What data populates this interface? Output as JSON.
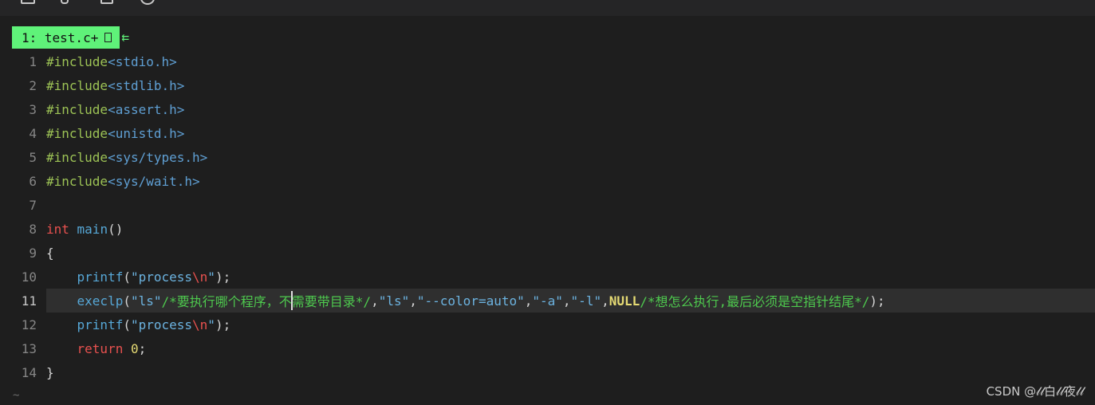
{
  "toolbar": {
    "icons": [
      "panel-icon",
      "pin-icon",
      "copy-icon",
      "info-icon"
    ]
  },
  "tabline": {
    "active_tab": "1: test.c+",
    "modified_marker": "",
    "arrow": "⇇"
  },
  "editor": {
    "line_numbers": [
      "1",
      "2",
      "3",
      "4",
      "5",
      "6",
      "7",
      "8",
      "9",
      "10",
      "11",
      "12",
      "13",
      "14"
    ],
    "current_line": 11,
    "lines": {
      "l1": {
        "pre": "#include",
        "inc": "<stdio.h>"
      },
      "l2": {
        "pre": "#include",
        "inc": "<stdlib.h>"
      },
      "l3": {
        "pre": "#include",
        "inc": "<assert.h>"
      },
      "l4": {
        "pre": "#include",
        "inc": "<unistd.h>"
      },
      "l5": {
        "pre": "#include",
        "inc": "<sys/types.h>"
      },
      "l6": {
        "pre": "#include",
        "inc": "<sys/wait.h>"
      },
      "l8": {
        "type": "int",
        "name": " main",
        "rest": "()"
      },
      "l9": {
        "brace": "{"
      },
      "l10": {
        "indent": "    ",
        "fn": "printf",
        "open": "(",
        "str1": "\"process",
        "esc": "\\n",
        "str2": "\"",
        "close": ");"
      },
      "l11": {
        "indent": "    ",
        "fn": "execlp",
        "open": "(",
        "arg1": "\"ls\"",
        "cmt1a": "/*要执行哪个程序，不",
        "cmt1b": "需要带目录*/",
        "sep1": ",",
        "arg2": "\"ls\"",
        "sep2": ",",
        "arg3": "\"--color=auto\"",
        "sep3": ",",
        "arg4": "\"-a\"",
        "sep4": ",",
        "arg5": "\"-l\"",
        "sep5": ",",
        "null": "NULL",
        "cmt2": "/*想怎么执行,最后必须是空指针结尾*/",
        "close": ");"
      },
      "l12": {
        "indent": "    ",
        "fn": "printf",
        "open": "(",
        "str1": "\"process",
        "esc": "\\n",
        "str2": "\"",
        "close": ");"
      },
      "l13": {
        "indent": "    ",
        "ret": "return",
        "space": " ",
        "num": "0",
        "semi": ";"
      },
      "l14": {
        "brace": "}"
      }
    }
  },
  "footer": {
    "tilde": "~",
    "watermark": "CSDN @𝓁𝓁白𝓁𝓁夜𝓁𝓁"
  }
}
